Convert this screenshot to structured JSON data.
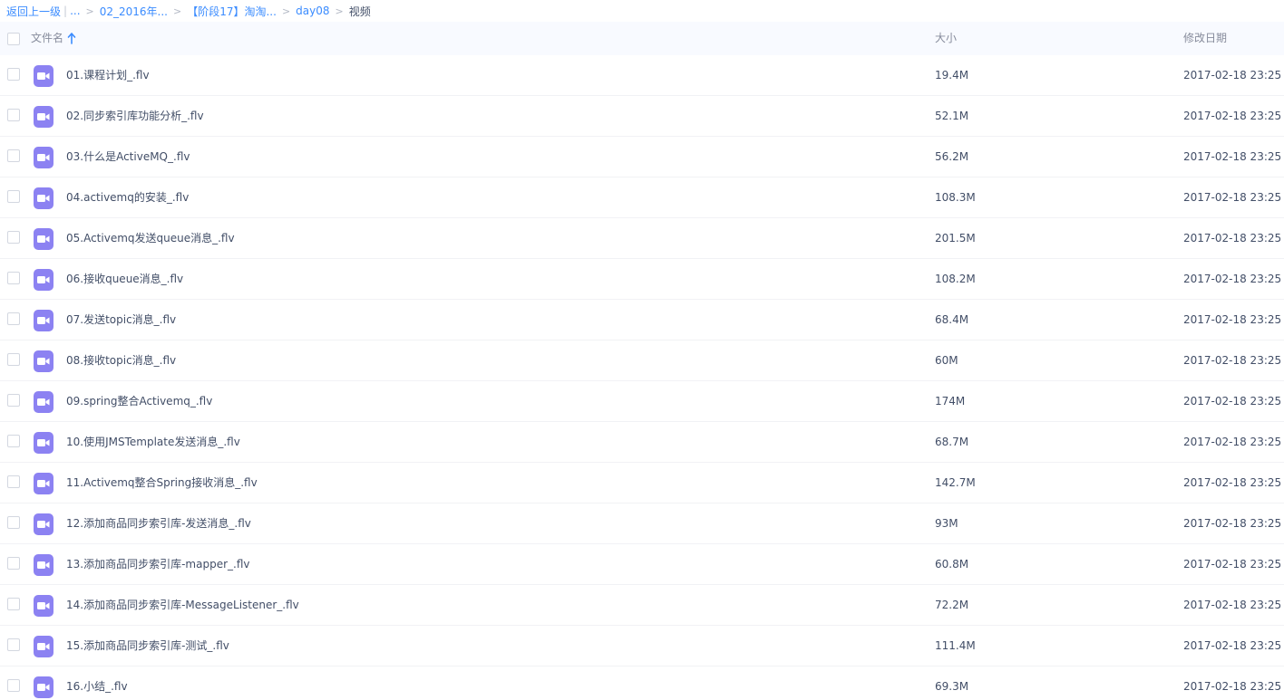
{
  "breadcrumb": {
    "back_label": "返回上一级",
    "pipe": "|",
    "ellipsis": "...",
    "separator": ">",
    "items": [
      "02_2016年...",
      "【阶段17】淘淘...",
      "day08"
    ],
    "current": "视频"
  },
  "columns": {
    "name": "文件名",
    "size": "大小",
    "date": "修改日期"
  },
  "colors": {
    "link": "#3b8cff",
    "video_icon": "#8c82f2",
    "text": "#424e67",
    "header_text": "#878c9c"
  },
  "files": [
    {
      "icon": "video-file-icon",
      "name": "01.课程计划_.flv",
      "size": "19.4M",
      "date": "2017-02-18 23:25"
    },
    {
      "icon": "video-file-icon",
      "name": "02.同步索引库功能分析_.flv",
      "size": "52.1M",
      "date": "2017-02-18 23:25"
    },
    {
      "icon": "video-file-icon",
      "name": "03.什么是ActiveMQ_.flv",
      "size": "56.2M",
      "date": "2017-02-18 23:25"
    },
    {
      "icon": "video-file-icon",
      "name": "04.activemq的安装_.flv",
      "size": "108.3M",
      "date": "2017-02-18 23:25"
    },
    {
      "icon": "video-file-icon",
      "name": "05.Activemq发送queue消息_.flv",
      "size": "201.5M",
      "date": "2017-02-18 23:25"
    },
    {
      "icon": "video-file-icon",
      "name": "06.接收queue消息_.flv",
      "size": "108.2M",
      "date": "2017-02-18 23:25"
    },
    {
      "icon": "video-file-icon",
      "name": "07.发送topic消息_.flv",
      "size": "68.4M",
      "date": "2017-02-18 23:25"
    },
    {
      "icon": "video-file-icon",
      "name": "08.接收topic消息_.flv",
      "size": "60M",
      "date": "2017-02-18 23:25"
    },
    {
      "icon": "video-file-icon",
      "name": "09.spring整合Activemq_.flv",
      "size": "174M",
      "date": "2017-02-18 23:25"
    },
    {
      "icon": "video-file-icon",
      "name": "10.使用JMSTemplate发送消息_.flv",
      "size": "68.7M",
      "date": "2017-02-18 23:25"
    },
    {
      "icon": "video-file-icon",
      "name": "11.Activemq整合Spring接收消息_.flv",
      "size": "142.7M",
      "date": "2017-02-18 23:25"
    },
    {
      "icon": "video-file-icon",
      "name": "12.添加商品同步索引库-发送消息_.flv",
      "size": "93M",
      "date": "2017-02-18 23:25"
    },
    {
      "icon": "video-file-icon",
      "name": "13.添加商品同步索引库-mapper_.flv",
      "size": "60.8M",
      "date": "2017-02-18 23:25"
    },
    {
      "icon": "video-file-icon",
      "name": "14.添加商品同步索引库-MessageListener_.flv",
      "size": "72.2M",
      "date": "2017-02-18 23:25"
    },
    {
      "icon": "video-file-icon",
      "name": "15.添加商品同步索引库-测试_.flv",
      "size": "111.4M",
      "date": "2017-02-18 23:25"
    },
    {
      "icon": "video-file-icon",
      "name": "16.小结_.flv",
      "size": "69.3M",
      "date": "2017-02-18 23:25"
    }
  ]
}
